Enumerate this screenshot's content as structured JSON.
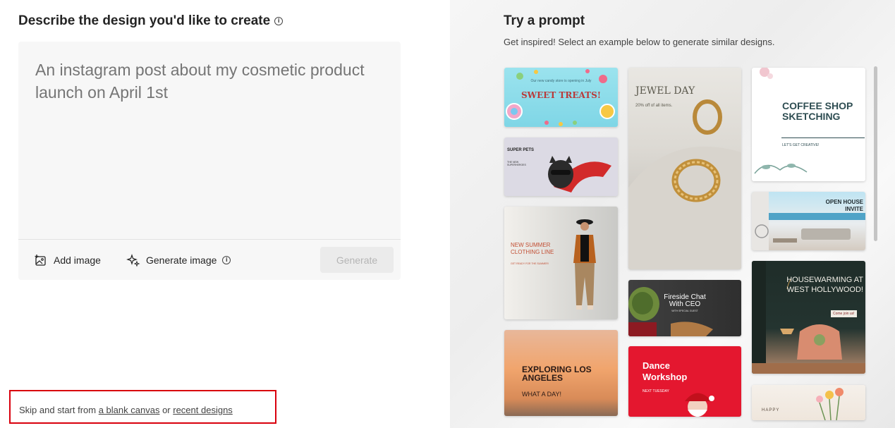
{
  "left": {
    "heading": "Describe the design you'd like to create",
    "prompt_placeholder": "An instagram post about my cosmetic product launch on April 1st",
    "add_image_label": "Add image",
    "generate_image_label": "Generate image",
    "generate_button": "Generate",
    "skip_prefix": "Skip and start from ",
    "blank_canvas_link": "a blank canvas",
    "skip_or": " or ",
    "recent_designs_link": "recent designs"
  },
  "right": {
    "title": "Try a prompt",
    "subtitle": "Get inspired! Select an example below to generate similar designs.",
    "cards": {
      "sweet": {
        "small": "Our new candy store is opening in July",
        "title": "SWEET TREATS!"
      },
      "pets": {
        "title": "SUPER PETS",
        "sub": "THE NEW SUPERHEROES"
      },
      "summer": {
        "title": "NEW SUMMER CLOTHING LINE",
        "sub": "GET READY FOR THE SUMMER!"
      },
      "la": {
        "title": "EXPLORING LOS ANGELES",
        "sub": "WHAT A DAY!"
      },
      "jewel": {
        "title": "JEWEL DAY",
        "sub": "20% off of all items."
      },
      "fireside": {
        "title": "Fireside Chat With CEO",
        "sub": "WITH SPECIAL GUEST"
      },
      "dance": {
        "title": "Dance Workshop",
        "sub": "NEXT TUESDAY"
      },
      "coffee": {
        "title": "COFFEE SHOP SKETCHING",
        "sub": "LET'S GET CREATIVE!"
      },
      "house": {
        "title": "OPEN HOUSE INVITE"
      },
      "warm": {
        "title": "HOUSEWARMING AT WEST HOLLYWOOD!",
        "sub": "Come join us!"
      },
      "happy": {
        "title": "HAPPY"
      }
    }
  },
  "colors": {
    "highlight": "#d9000d",
    "placeholder": "#a8a8a8"
  }
}
